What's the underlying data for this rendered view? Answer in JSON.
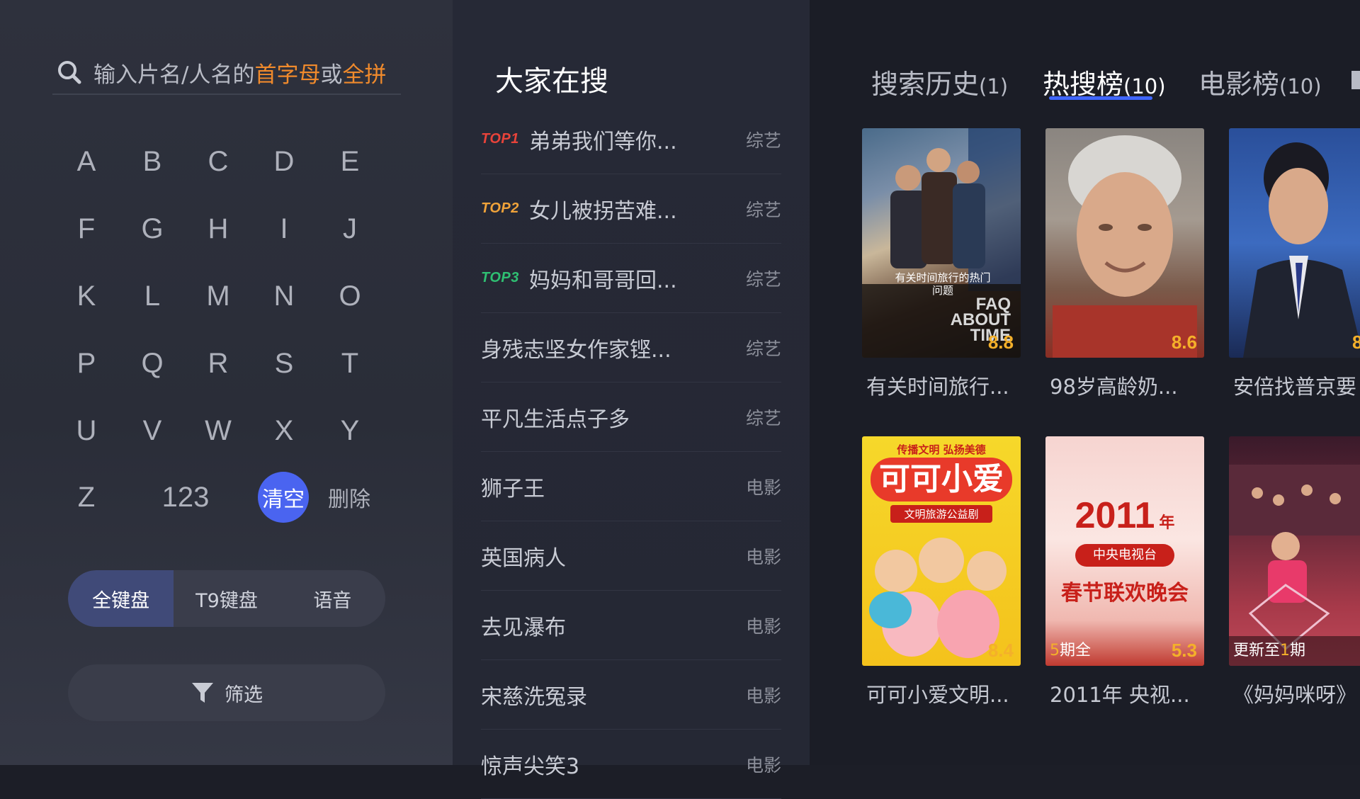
{
  "search": {
    "placeholder_prefix": "输入片名/人名的",
    "placeholder_hl1": "首字母",
    "placeholder_mid": "或",
    "placeholder_hl2": "全拼"
  },
  "keyboard": {
    "rows": [
      [
        "A",
        "B",
        "C",
        "D",
        "E"
      ],
      [
        "F",
        "G",
        "H",
        "I",
        "J"
      ],
      [
        "K",
        "L",
        "M",
        "N",
        "O"
      ],
      [
        "P",
        "Q",
        "R",
        "S",
        "T"
      ],
      [
        "U",
        "V",
        "W",
        "X",
        "Y"
      ]
    ],
    "z": "Z",
    "numbers": "123",
    "clear": "清空",
    "delete": "删除"
  },
  "modes": [
    "全键盘",
    "T9键盘",
    "语音"
  ],
  "filter_label": "筛选",
  "popular": {
    "title": "大家在搜",
    "items": [
      {
        "rank": "TOP1",
        "rank_color": "#e8433a",
        "name": "弟弟我们等你...",
        "category": "综艺"
      },
      {
        "rank": "TOP2",
        "rank_color": "#f0a33a",
        "name": "女儿被拐苦难...",
        "category": "综艺"
      },
      {
        "rank": "TOP3",
        "rank_color": "#2fbf72",
        "name": "妈妈和哥哥回...",
        "category": "综艺"
      },
      {
        "rank": "",
        "rank_color": "",
        "name": "身残志坚女作家铿...",
        "category": "综艺"
      },
      {
        "rank": "",
        "rank_color": "",
        "name": "平凡生活点子多",
        "category": "综艺"
      },
      {
        "rank": "",
        "rank_color": "",
        "name": "狮子王",
        "category": "电影"
      },
      {
        "rank": "",
        "rank_color": "",
        "name": "英国病人",
        "category": "电影"
      },
      {
        "rank": "",
        "rank_color": "",
        "name": "去见瀑布",
        "category": "电影"
      },
      {
        "rank": "",
        "rank_color": "",
        "name": "宋慈洗冤录",
        "category": "电影"
      },
      {
        "rank": "",
        "rank_color": "",
        "name": "惊声尖笑3",
        "category": "电影"
      }
    ]
  },
  "tabs": [
    {
      "label": "搜索历史",
      "count": "(1)"
    },
    {
      "label": "热搜榜",
      "count": "(10)"
    },
    {
      "label": "电影榜",
      "count": "(10)"
    }
  ],
  "results": [
    {
      "title": "有关时间旅行...",
      "score": "8.8",
      "episode": "",
      "poster_text": "有关时间旅行的热门问题",
      "poster_text2": "FAQ ABOUT TIME"
    },
    {
      "title": "98岁高龄奶...",
      "score": "8.6",
      "episode": ""
    },
    {
      "title": "安倍找普京要",
      "score": "8",
      "episode": ""
    },
    {
      "title": "可可小爱文明...",
      "score": "8.4",
      "episode": "",
      "poster_top": "传播文明 弘扬美德",
      "poster_main": "可可小爱",
      "poster_sub": "文明旅游公益剧"
    },
    {
      "title": "2011年 央视...",
      "score": "5.3",
      "episode_pre": "5",
      "episode": "期全",
      "poster_year": "2011",
      "poster_year_suffix": "年",
      "poster_channel": "中央电视台",
      "poster_main": "春节联欢晚会"
    },
    {
      "title": "《妈妈咪呀》",
      "score": "",
      "episode_pre": "更新至",
      "episode_num": "1",
      "episode": "期"
    }
  ],
  "colors": {
    "accent": "#4a64f0",
    "highlight": "#f08a2c",
    "score": "#f4b02a",
    "tab_underline": "#3f66ff"
  }
}
